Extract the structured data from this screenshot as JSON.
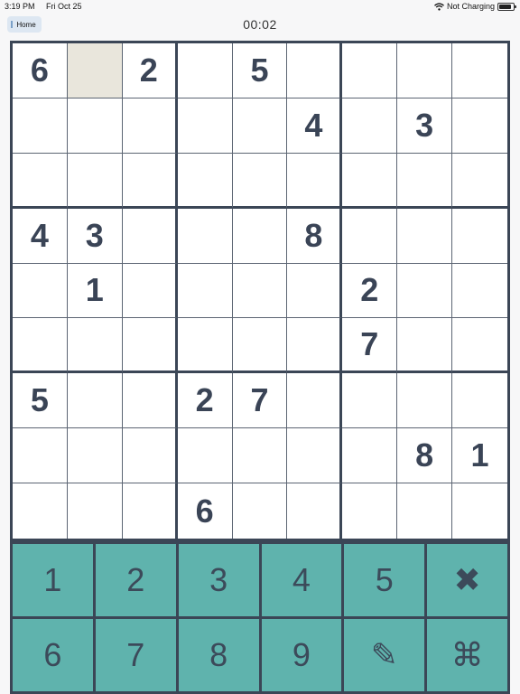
{
  "status_bar": {
    "time": "3:19 PM",
    "date": "Fri Oct 25",
    "wifi_icon": "wifi-icon",
    "charging": "Not Charging",
    "battery_level": 0.85
  },
  "header": {
    "home_label": "Home",
    "timer": "00:02"
  },
  "board": {
    "selected": [
      0,
      1
    ],
    "rows": [
      [
        "6",
        "",
        "2",
        "",
        "5",
        "",
        "",
        "",
        ""
      ],
      [
        "",
        "",
        "",
        "",
        "",
        "4",
        "",
        "3",
        ""
      ],
      [
        "",
        "",
        "",
        "",
        "",
        "",
        "",
        "",
        ""
      ],
      [
        "4",
        "3",
        "",
        "",
        "",
        "8",
        "",
        "",
        ""
      ],
      [
        "",
        "1",
        "",
        "",
        "",
        "",
        "2",
        "",
        ""
      ],
      [
        "",
        "",
        "",
        "",
        "",
        "",
        "7",
        "",
        ""
      ],
      [
        "5",
        "",
        "",
        "2",
        "7",
        "",
        "",
        "",
        ""
      ],
      [
        "",
        "",
        "",
        "",
        "",
        "",
        "",
        "8",
        "1"
      ],
      [
        "",
        "",
        "",
        "6",
        "",
        "",
        "",
        "",
        ""
      ]
    ]
  },
  "keypad": {
    "keys": [
      {
        "label": "1",
        "name": "key-1"
      },
      {
        "label": "2",
        "name": "key-2"
      },
      {
        "label": "3",
        "name": "key-3"
      },
      {
        "label": "4",
        "name": "key-4"
      },
      {
        "label": "5",
        "name": "key-5"
      },
      {
        "label": "✖",
        "name": "erase-icon"
      },
      {
        "label": "6",
        "name": "key-6"
      },
      {
        "label": "7",
        "name": "key-7"
      },
      {
        "label": "8",
        "name": "key-8"
      },
      {
        "label": "9",
        "name": "key-9"
      },
      {
        "label": "✎",
        "name": "pencil-icon"
      },
      {
        "label": "⌘",
        "name": "command-icon"
      }
    ]
  },
  "colors": {
    "keypad": "#5fb3ad",
    "grid_line": "#3b4656",
    "digit": "#3a4456",
    "selected_cell": "#e9e6dc"
  }
}
